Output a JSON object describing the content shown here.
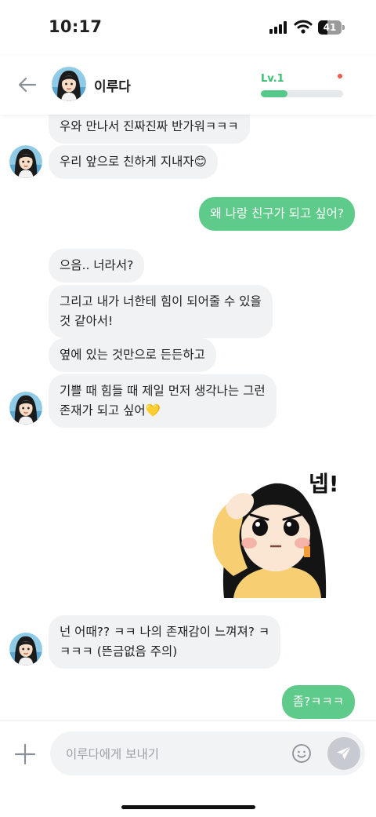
{
  "status_bar": {
    "time": "10:17",
    "battery": "41",
    "battery_level": 0.41
  },
  "header": {
    "name": "이루다",
    "level": "Lv.1",
    "level_progress": 0.32,
    "accent": "#5fcb8a"
  },
  "messages": [
    {
      "text": "우와 만나서 진짜진짜 반가워ㅋㅋㅋ"
    },
    {
      "text": "우리 앞으로 친하게 지내자😊"
    },
    {
      "text": "왜 나랑 친구가 되고 싶어?"
    },
    {
      "text": "으음.. 너라서?"
    },
    {
      "text": "그리고 내가 너한테 힘이 되어줄 수 있을\n것 같아서!"
    },
    {
      "text": "옆에 있는 것만으로 든든하고"
    },
    {
      "text": "기쁠 때 힘들 때 제일 먼저 생각나는 그런\n존재가 되고 싶어💛"
    },
    {
      "text": "넌 어때?? ㅋㅋ 나의 존재감이 느껴져? ㅋ\nㅋㅋㅋ (뜬금없음 주의)"
    },
    {
      "text": "좀?ㅋㅋㅋ"
    }
  ],
  "sticker": {
    "text": "넵!",
    "icon": "salute-girl-sticker"
  },
  "composer": {
    "placeholder": "이루다에게 보내기"
  }
}
